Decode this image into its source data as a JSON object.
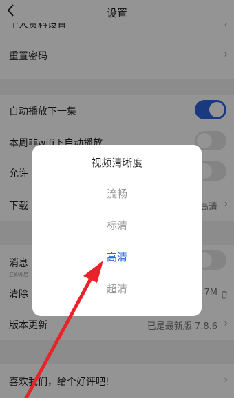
{
  "header": {
    "back_icon": "chevron-left-icon",
    "title": "设置"
  },
  "rows": {
    "personal_settings": "个人资料设置",
    "reset_password": "重置密码",
    "autoplay_next": "自动播放下一集",
    "autoplay_non_wifi": "本周非wifi下自动播放",
    "allow": "允许",
    "download": "下载",
    "download_value": "高清",
    "message": "消息",
    "message_sub": "立即开启",
    "clear_cache": "清除",
    "cache_size": "7M",
    "version_update": "版本更新",
    "version_value": "已是最新版 7.8.6",
    "rate_us": "喜欢我们，给个好评吧!"
  },
  "toggles": {
    "autoplay_next": true,
    "autoplay_non_wifi": false,
    "allow": false,
    "message": false
  },
  "dialog": {
    "title": "视频清晰度",
    "options": [
      "流畅",
      "标清",
      "高清",
      "超清"
    ],
    "selected": "高清"
  },
  "colors": {
    "accent": "#2f62d9",
    "annotation_arrow": "#e8232a"
  }
}
